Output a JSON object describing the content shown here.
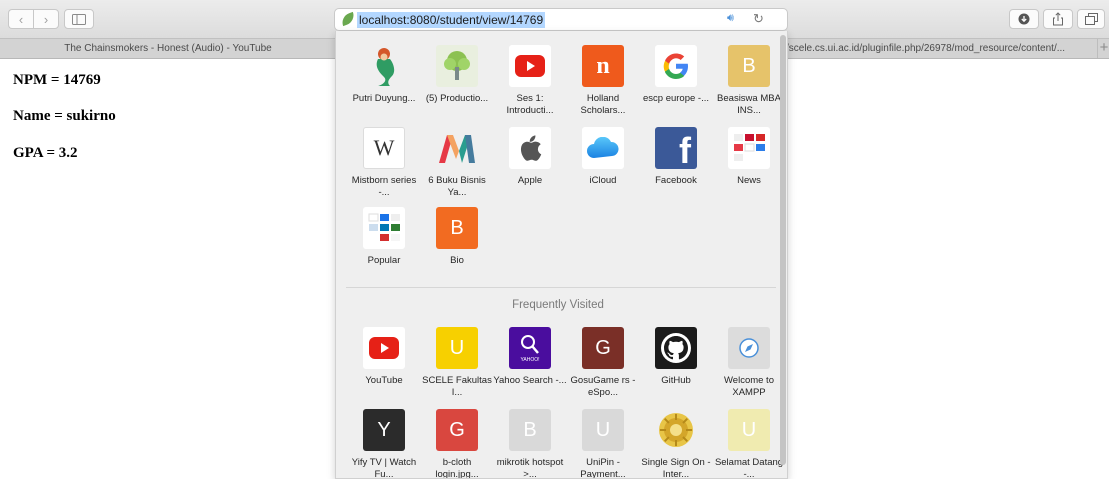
{
  "toolbar": {
    "back_icon": "chevron-left",
    "forward_icon": "chevron-right",
    "sidebar_icon": "sidebar",
    "download_icon": "download",
    "share_icon": "share",
    "tabs_icon": "tabs"
  },
  "urlbar": {
    "url": "localhost:8080/student/view/14769",
    "audio_icon": "speaker",
    "reload_icon": "reload"
  },
  "tabs": [
    {
      "title": "The Chainsmokers - Honest (Audio) - YouTube"
    },
    {
      "title": "/scele.cs.ui.ac.id/pluginfile.php/26978/mod_resource/content/..."
    }
  ],
  "page": {
    "lines": [
      "NPM = 14769",
      "Name = sukirno",
      "GPA = 3.2"
    ]
  },
  "favorites": [
    {
      "label": "Putri Duyung...",
      "icon": "mermaid"
    },
    {
      "label": "(5) Productio...",
      "icon": "tree"
    },
    {
      "label": "Ses 1: Introducti...",
      "icon": "youtube"
    },
    {
      "label": "Holland Scholars...",
      "icon": "letter-n",
      "color": "#ef5a1c"
    },
    {
      "label": "escp europe -...",
      "icon": "google"
    },
    {
      "label": "Beasiswa MBA INS...",
      "icon": "letter-b",
      "color": "#e6c36a"
    },
    {
      "label": "Mistborn series -...",
      "icon": "wikipedia"
    },
    {
      "label": "6 Buku Bisnis Ya...",
      "icon": "colorful-m"
    },
    {
      "label": "Apple",
      "icon": "apple"
    },
    {
      "label": "iCloud",
      "icon": "cloud"
    },
    {
      "label": "Facebook",
      "icon": "facebook"
    },
    {
      "label": "News",
      "icon": "news-grid"
    },
    {
      "label": "Popular",
      "icon": "popular-grid"
    },
    {
      "label": "Bio",
      "icon": "letter-b",
      "color": "#f26b21"
    }
  ],
  "frequently_visited": {
    "title": "Frequently Visited",
    "items": [
      {
        "label": "YouTube",
        "icon": "youtube"
      },
      {
        "label": "SCELE Fakultas I...",
        "icon": "letter-u",
        "color": "#f7d000"
      },
      {
        "label": "Yahoo Search -...",
        "icon": "yahoo-search"
      },
      {
        "label": "GosuGame rs - eSpo...",
        "icon": "letter-g",
        "color": "#7a2f27"
      },
      {
        "label": "GitHub",
        "icon": "github"
      },
      {
        "label": "Welcome to XAMPP",
        "icon": "compass"
      },
      {
        "label": "Yify TV | Watch Fu...",
        "icon": "letter-y",
        "color": "#2b2b2b"
      },
      {
        "label": "b-cloth login.jpg...",
        "icon": "letter-g",
        "color": "#d9473f"
      },
      {
        "label": "mikrotik hotspot >...",
        "icon": "letter-b",
        "color": "#d9d9d9"
      },
      {
        "label": "UniPin - Payment...",
        "icon": "letter-u",
        "color": "#d9d9d9"
      },
      {
        "label": "Single Sign On - Inter...",
        "icon": "ui-emblem"
      },
      {
        "label": "Selamat Datang -...",
        "icon": "letter-u",
        "color": "#f0ebb0"
      }
    ]
  },
  "letters": {
    "n": "n",
    "b": "B",
    "u": "U",
    "g": "G",
    "y": "Y",
    "w": "W",
    "f": "f"
  }
}
